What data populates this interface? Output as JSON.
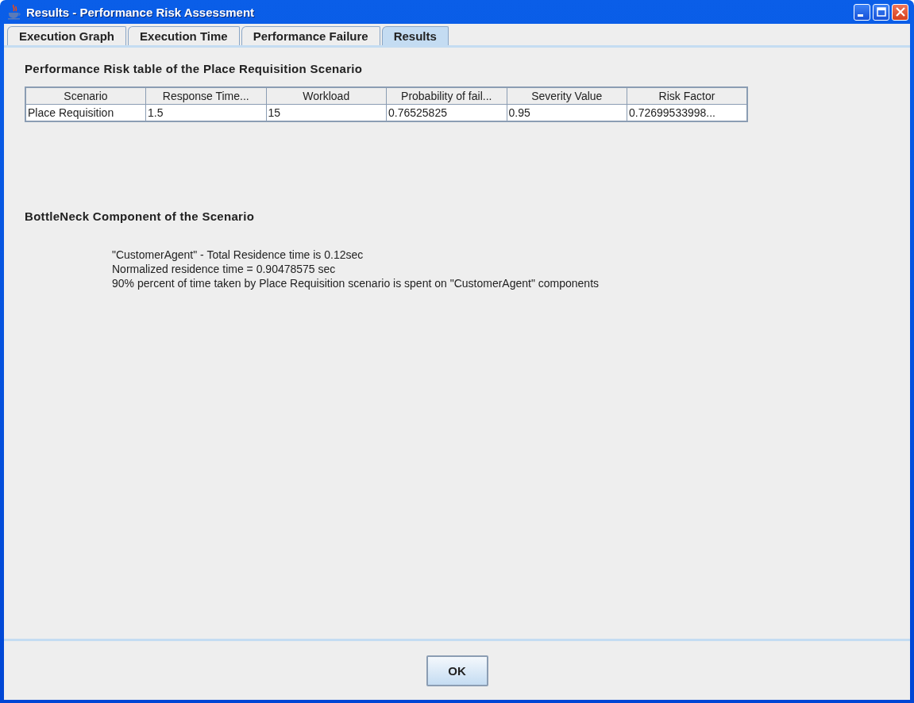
{
  "window": {
    "title": "Results - Performance Risk Assessment"
  },
  "tabs": [
    {
      "label": "Execution Graph",
      "selected": false
    },
    {
      "label": "Execution Time",
      "selected": false
    },
    {
      "label": "Performance Failure",
      "selected": false
    },
    {
      "label": "Results",
      "selected": true
    }
  ],
  "risk_table": {
    "title": "Performance Risk table of the Place Requisition Scenario",
    "columns": [
      "Scenario",
      "Response Time...",
      "Workload",
      "Probability of fail...",
      "Severity Value",
      "Risk Factor"
    ],
    "rows": [
      [
        "Place Requisition",
        "1.5",
        "15",
        "0.76525825",
        "0.95",
        "0.72699533998..."
      ]
    ]
  },
  "bottleneck": {
    "title": "BottleNeck Component of the Scenario",
    "lines": [
      "\"CustomerAgent\" - Total Residence time is 0.12sec",
      "Normalized residence time = 0.90478575 sec",
      "90% percent of time taken by Place Requisition scenario is spent on \"CustomerAgent\" components"
    ]
  },
  "buttons": [
    "OK"
  ]
}
